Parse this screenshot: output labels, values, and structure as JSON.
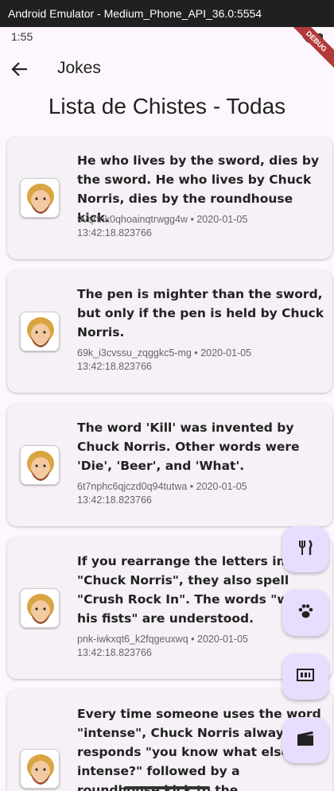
{
  "window": {
    "title": "Android Emulator - Medium_Phone_API_36.0:5554"
  },
  "status_bar": {
    "time": "1:55",
    "debug_label": "DEBUG"
  },
  "app_bar": {
    "title": "Jokes"
  },
  "page": {
    "title": "Lista de Chistes - Todas"
  },
  "jokes": [
    {
      "text": "He who lives by the sword, dies by the sword. He who lives by Chuck Norris, dies by the roundhouse kick.",
      "id": "9vqrfnk0qhoainqtrwgg4w",
      "date": "2020-01-05",
      "time": "13:42:18.823766"
    },
    {
      "text": "The pen is mighter than the sword, but only if the pen is held by Chuck Norris.",
      "id": "69k_i3cvssu_zqggkc5-mg",
      "date": "2020-01-05",
      "time": "13:42:18.823766"
    },
    {
      "text": "The word 'Kill' was invented by Chuck Norris. Other words were 'Die', 'Beer', and 'What'.",
      "id": "6t7nphc6qjczd0q94tutwa",
      "date": "2020-01-05",
      "time": "13:42:18.823766"
    },
    {
      "text": "If you rearrange the letters in \"Chuck Norris\", they also spell \"Crush Rock In\". The words \"with his fists\" are understood.",
      "id": "pnk-iwkxqt6_k2fqgeuxwq",
      "date": "2020-01-05",
      "time": "13:42:18.823766"
    },
    {
      "text": "Every time someone uses the word \"intense\", Chuck Norris always responds \"you know what else is intense?\" followed by a roundhouse kick to the",
      "id": "",
      "date": "",
      "time": ""
    }
  ],
  "meta_separator": "•",
  "fabs": [
    {
      "icon": "restaurant-icon"
    },
    {
      "icon": "pets-icon"
    },
    {
      "icon": "money-icon"
    },
    {
      "icon": "movie-icon"
    }
  ],
  "colors": {
    "background": "#fdf7fd",
    "card": "#f6f0f7",
    "fab": "#e9ddff"
  }
}
